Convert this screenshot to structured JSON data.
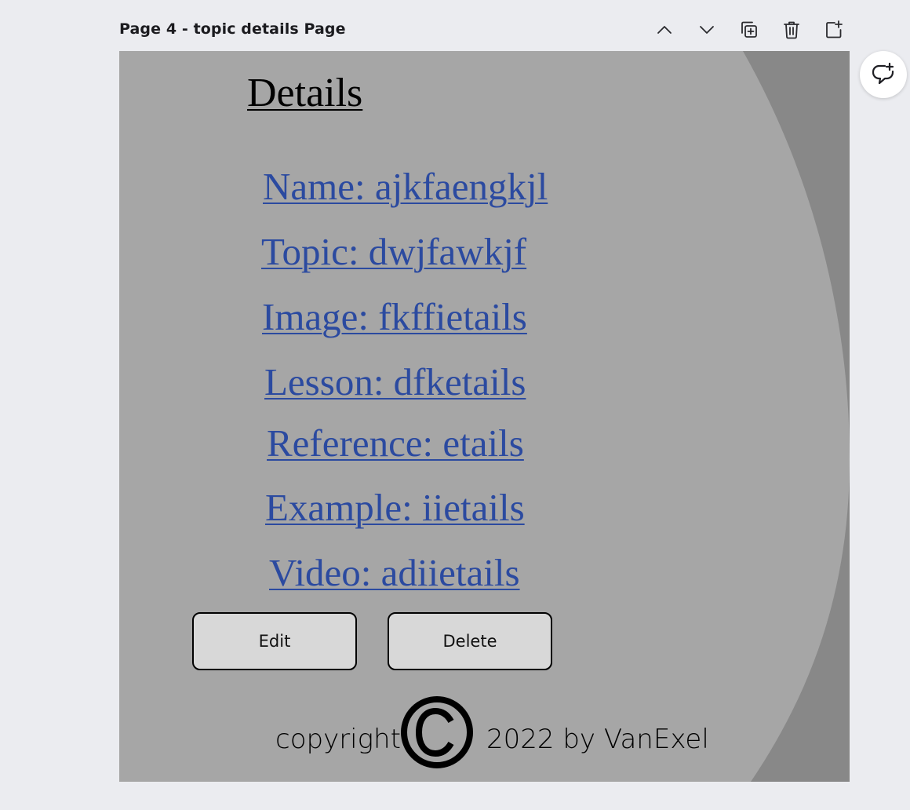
{
  "page": {
    "title": "Page 4 - topic details Page"
  },
  "toolbar": {
    "icons": [
      "chevron-up-icon",
      "chevron-down-icon",
      "duplicate-page-icon",
      "trash-icon",
      "add-page-icon"
    ],
    "comment_icon": "add-comment-icon"
  },
  "content": {
    "heading": "Details",
    "fields": [
      "Name: ajkfaengkjl",
      "Topic: dwjfawkjf",
      "Image: fkffietails",
      "Lesson: dfketails",
      "Reference: etails",
      "Example: iietails",
      "Video: adiietails"
    ],
    "edit_label": "Edit",
    "delete_label": "Delete"
  },
  "footer": {
    "copyright_word": "copyright",
    "year_author": "2022 by VanExel"
  },
  "colors": {
    "workspace_bg": "#ebecf0",
    "canvas_light": "#a6a6a6",
    "canvas_dark": "#888888",
    "link": "#2b4aa0",
    "button_fill": "#d8d8d8"
  }
}
